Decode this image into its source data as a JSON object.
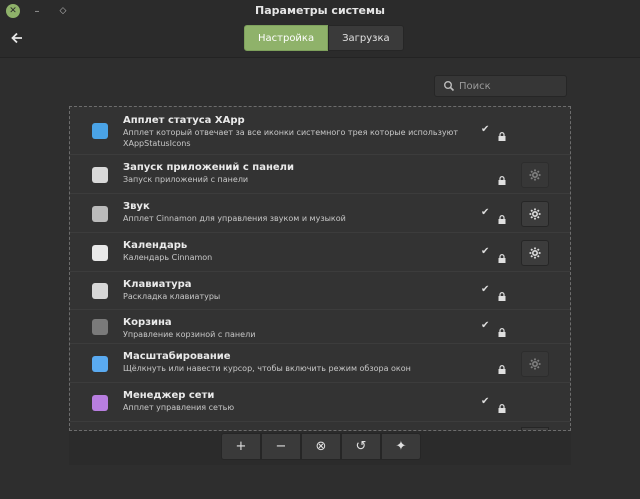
{
  "window": {
    "title": "Параметры системы"
  },
  "header": {
    "tabs": [
      {
        "label": "Настройка",
        "active": true
      },
      {
        "label": "Загрузка",
        "active": false
      }
    ]
  },
  "search": {
    "placeholder": "Поиск",
    "value": ""
  },
  "applets": [
    {
      "name": "Апплет статуса XApp",
      "desc1": "Апплет который отвечает за все иконки системного трея которые используют",
      "desc2": "XAppStatusIcons",
      "icon": "xapp-status-icon",
      "color": "#4aa3e6",
      "checked": true,
      "configurable": false
    },
    {
      "name": "Запуск приложений с панели",
      "desc1": "Запуск приложений с панели",
      "desc2": "",
      "icon": "launcher-icon",
      "color": "#d9d9d9",
      "checked": false,
      "configurable": true,
      "config_enabled": false
    },
    {
      "name": "Звук",
      "desc1": "Апплет Cinnamon для управления звуком и музыкой",
      "desc2": "",
      "icon": "sound-icon",
      "color": "#bbbbbb",
      "checked": true,
      "configurable": true,
      "config_enabled": true
    },
    {
      "name": "Календарь",
      "desc1": "Календарь Cinnamon",
      "desc2": "",
      "icon": "calendar-icon",
      "color": "#e8e8e8",
      "checked": true,
      "configurable": true,
      "config_enabled": true
    },
    {
      "name": "Клавиатура",
      "desc1": "Раскладка клавиатуры",
      "desc2": "",
      "icon": "keyboard-icon",
      "color": "#d7d7d7",
      "checked": true,
      "configurable": false
    },
    {
      "name": "Корзина",
      "desc1": "Управление корзиной с панели",
      "desc2": "",
      "icon": "trash-icon",
      "color": "#7a7a7a",
      "checked": true,
      "configurable": false
    },
    {
      "name": "Масштабирование",
      "desc1": "Щёлкнуть или навести курсор, чтобы включить режим обзора окон",
      "desc2": "",
      "icon": "scale-icon",
      "color": "#5aaaf0",
      "checked": false,
      "configurable": true,
      "config_enabled": false
    },
    {
      "name": "Менеджер сети",
      "desc1": "Апплет управления сетью",
      "desc2": "",
      "icon": "network-icon",
      "color": "#b87ee0",
      "checked": true,
      "configurable": false
    }
  ],
  "toolbar": {
    "add": "+",
    "remove": "−",
    "clear": "⊗",
    "undo": "↺",
    "more": "✦"
  }
}
